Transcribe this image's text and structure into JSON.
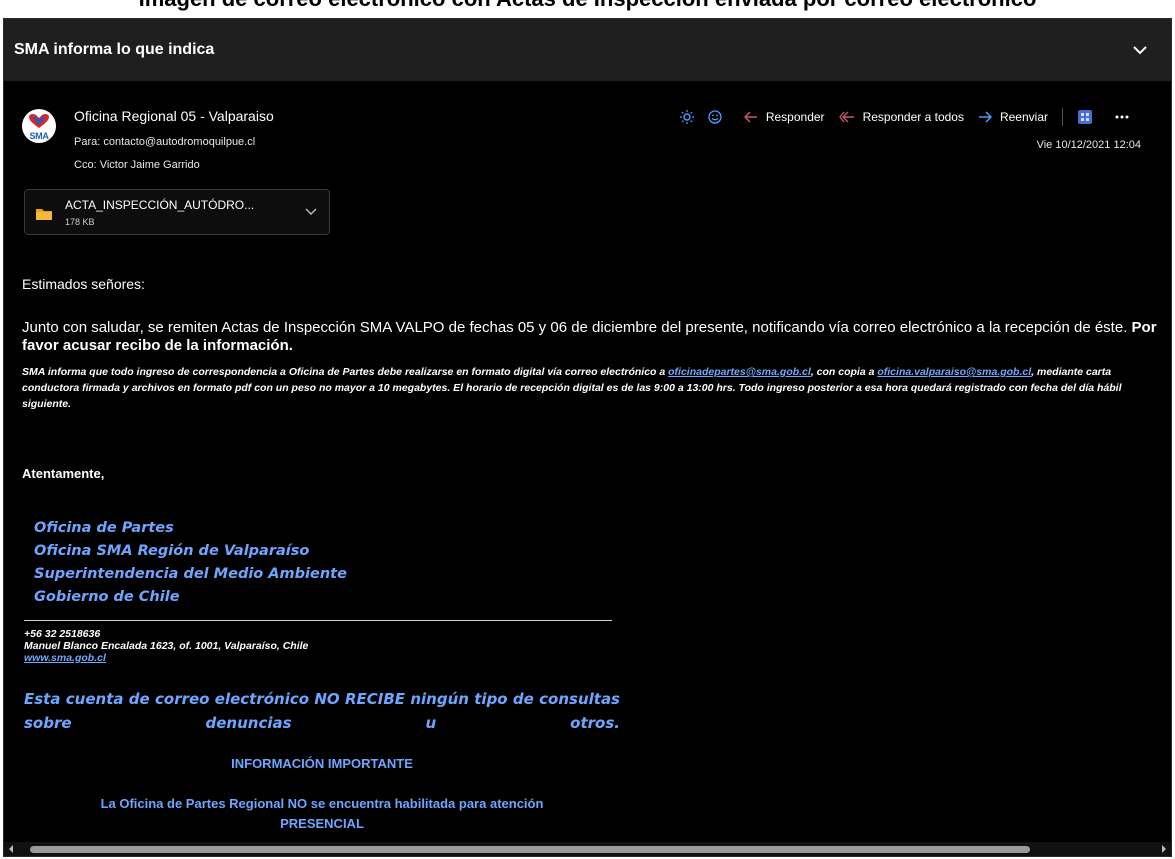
{
  "cutoff_caption": "Imagen de correo electrónico con Actas de Inspección enviada por correo electrónico",
  "email": {
    "subject": "SMA informa lo que indica",
    "sender": "Oficina Regional 05 - Valparaiso",
    "avatar_text": "SMA",
    "to_label": "Para:",
    "to": "contacto@autodromoquilpue.cl",
    "cc_label": "Cco:",
    "cc": "Victor Jaime Garrido",
    "date": "Vie 10/12/2021 12:04",
    "actions": {
      "reply": "Responder",
      "reply_all": "Responder a todos",
      "forward": "Reenviar"
    },
    "attachment": {
      "name": "ACTA_INSPECCIÓN_AUTÓDRO...",
      "size": "178 KB"
    }
  },
  "body": {
    "greeting": "Estimados señores:",
    "paragraph": "Junto con saludar, se remiten Actas de Inspección SMA VALPO de fechas 05 y 06 de diciembre del presente, notificando vía correo electrónico a la recepción de éste. ",
    "paragraph_bold": "Por favor acusar recibo de la información.",
    "notice_1": "SMA informa que todo ingreso de correspondencia a Oficina de Partes debe realizarse en formato digital vía correo electrónico a ",
    "notice_link_1": "oficinadepartes@sma.gob.cl",
    "notice_2": ", con copia a ",
    "notice_link_2": "oficina.valparaiso@sma.gob.cl",
    "notice_3": ", mediante carta conductora firmada y archivos en formato pdf con un peso no mayor a 10 megabytes. El horario de recepción digital es de las 9:00 a 13:00 hrs. Todo ingreso posterior a esa hora quedará registrado con fecha del día hábil siguiente.",
    "closing": "Atentamente,",
    "signature": [
      "Oficina de Partes",
      "Oficina SMA Región de Valparaíso",
      "Superintendencia del Medio Ambiente",
      "Gobierno de Chile"
    ],
    "phone": "+56 32 2518636",
    "address": "Manuel Blanco Encalada 1623, of. 1001, Valparaíso, Chile",
    "website": "www.sma.gob.cl",
    "no_consultas": "Esta cuenta de correo electrónico NO RECIBE ningún tipo de consultas sobre denuncias u otros.",
    "info_title": "INFORMACIÓN IMPORTANTE",
    "info_line_1": "La Oficina de Partes Regional NO se encuentra habilitada para atención",
    "info_line_2": "PRESENCIAL"
  },
  "colors": {
    "background": "#000000",
    "subject_bar": "#1f1f1f",
    "link_blue": "#6fa8ff",
    "signature_blue": "#6ea6ff"
  },
  "icons": [
    "chevron-down-icon",
    "sma-logo-avatar",
    "sun-icon",
    "emoji-icon",
    "reply-icon",
    "reply-all-icon",
    "forward-icon",
    "teams-icon",
    "more-icon",
    "folder-icon",
    "attachment-dropdown-icon",
    "scroll-left-icon",
    "scroll-right-icon"
  ]
}
